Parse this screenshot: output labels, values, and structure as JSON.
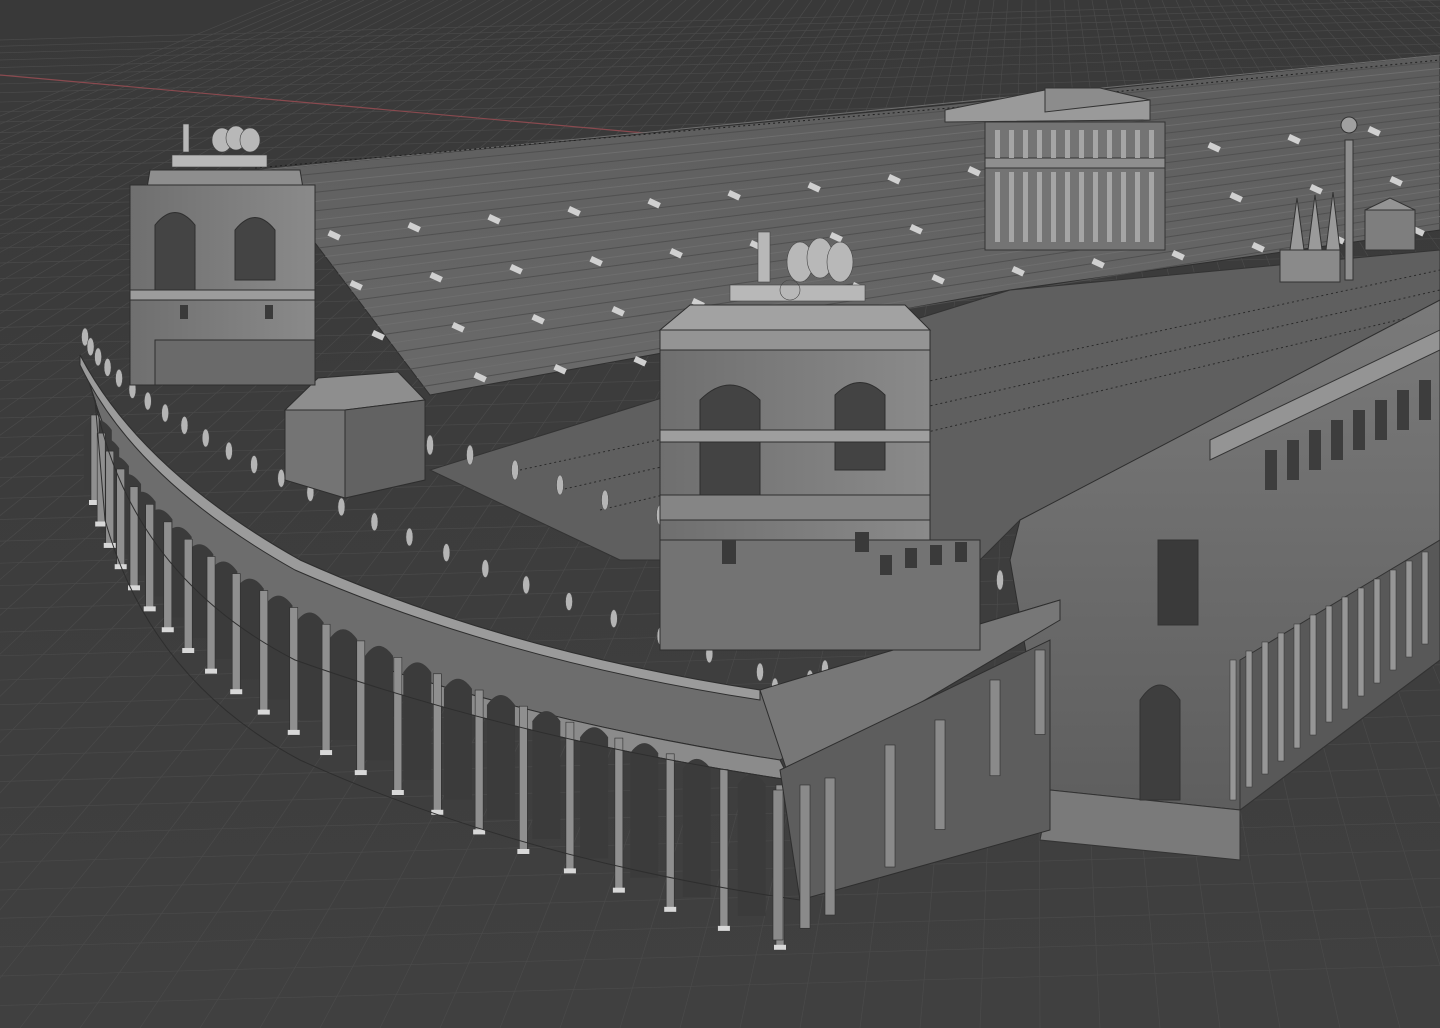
{
  "viewport": {
    "type": "3d-viewport",
    "shading": "solid",
    "overlays": {
      "grid_floor": true,
      "x_axis_line": true
    }
  },
  "scene": {
    "subject": "circus-model",
    "object_groups": [
      "seating-tiers",
      "carceres-arcade",
      "gate-tower-left",
      "gate-tower-right",
      "pulvinar-temple",
      "spina-meta",
      "spina-obelisk",
      "long-side-arcade"
    ]
  },
  "colors": {
    "background": "#3d3d3d",
    "grid_line": "#4a4a4a",
    "x_axis": "#8a4a4f",
    "model_light": "#8f8f8f",
    "model_mid": "#6b6b6b",
    "model_dark": "#3e3e3e"
  }
}
